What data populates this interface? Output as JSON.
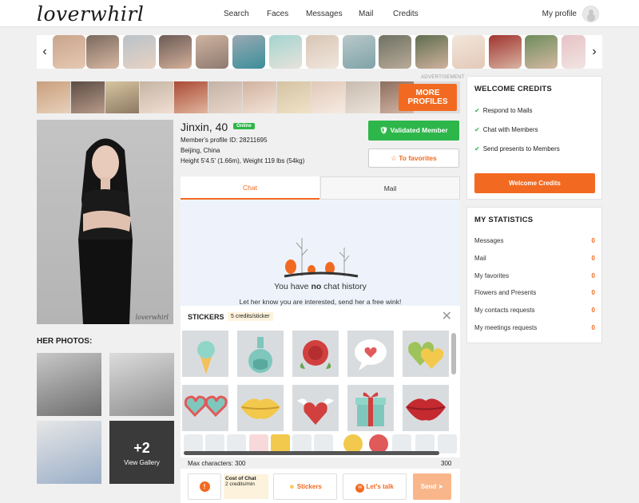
{
  "header": {
    "logo": "loverwhirl",
    "nav": [
      "Search",
      "Faces",
      "Messages",
      "Mail",
      "Credits"
    ],
    "my_profile": "My profile"
  },
  "strip": {
    "prev_icon": "chevron-left-icon",
    "next_icon": "chevron-right-icon"
  },
  "ad": {
    "label": "ADVERTISEMENT",
    "more_profiles": "MORE PROFILES"
  },
  "profile": {
    "name_age": "Jinxin, 40",
    "online": "Online",
    "id_line": "Member's profile ID: 28211695",
    "location": "Beijing, China",
    "height_weight": "Height 5'4.5' (1.66m), Weight 119 lbs (54kg)",
    "watermark": "loverwhirl"
  },
  "actions": {
    "validated": "Validated Member",
    "to_favorites": "To favorites"
  },
  "gallery": {
    "title": "HER PHOTOS:",
    "more_count": "+2",
    "view_gallery": "View Gallery"
  },
  "chat": {
    "tabs": [
      "Chat",
      "Mail"
    ],
    "no_history_prefix": "You have ",
    "no_history_bold": "no",
    "no_history_suffix": " chat history",
    "let_know": "Let her know you are interested, send her a free wink!"
  },
  "stickers": {
    "title": "STICKERS",
    "cost": "5 credits/sticker",
    "items": [
      "ice-cream",
      "potion-bottle",
      "rose",
      "heart-speech-bubble",
      "hearts",
      "heart-glasses",
      "lips",
      "winged-heart",
      "gift-box",
      "red-lips"
    ]
  },
  "composer": {
    "max_chars_label": "Max characters: 300",
    "max_chars_value": "300",
    "cost_of_chat": "Cost of Chat",
    "cost_value": "2 credits/min",
    "stickers_btn": "Stickers",
    "lets_talk_btn": "Let's talk",
    "send_btn": "Send"
  },
  "welcome": {
    "title": "WELCOME CREDITS",
    "items": [
      "Respond to Mails",
      "Chat with Members",
      "Send presents to Members"
    ],
    "button": "Welcome Credits"
  },
  "stats": {
    "title": "MY STATISTICS",
    "rows": [
      {
        "label": "Messages",
        "value": "0"
      },
      {
        "label": "Mail",
        "value": "0"
      },
      {
        "label": "My favorites",
        "value": "0"
      },
      {
        "label": "Flowers and Presents",
        "value": "0"
      },
      {
        "label": "My contacts requests",
        "value": "0"
      },
      {
        "label": "My meetings requests",
        "value": "0"
      }
    ]
  },
  "colors": {
    "accent": "#f26a21",
    "success": "#2db64a",
    "chat_bg": "#eef3fb"
  }
}
